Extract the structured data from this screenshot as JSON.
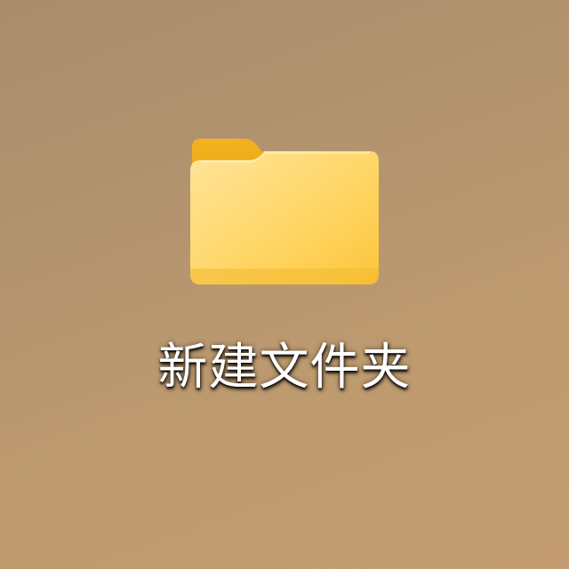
{
  "desktop": {
    "background_colors": [
      "#a98c6c",
      "#c29c70"
    ],
    "icons": [
      {
        "icon": "folder-icon",
        "label": "新建文件夹",
        "colors": {
          "tab": "#f0b01c",
          "body_light": "#ffe08a",
          "body_dark": "#fcc63a"
        }
      }
    ]
  }
}
